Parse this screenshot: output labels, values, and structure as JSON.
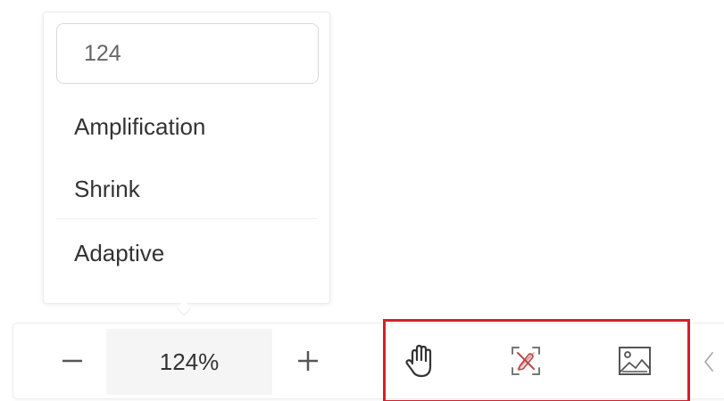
{
  "zoom_menu": {
    "input_value": "124",
    "items": [
      {
        "label": "Amplification"
      },
      {
        "label": "Shrink"
      },
      {
        "label": "Adaptive"
      }
    ]
  },
  "toolbar": {
    "zoom_out_icon": "minus-icon",
    "zoom_level": "124%",
    "zoom_in_icon": "plus-icon",
    "tools": [
      {
        "icon": "hand-icon"
      },
      {
        "icon": "hide-annotation-icon"
      },
      {
        "icon": "image-icon"
      }
    ],
    "collapse_icon": "chevron-left-icon"
  },
  "colors": {
    "highlight": "#d71e2a",
    "text": "#333333",
    "muted_text": "#666666",
    "zoom_value_bg": "#f5f5f5"
  }
}
